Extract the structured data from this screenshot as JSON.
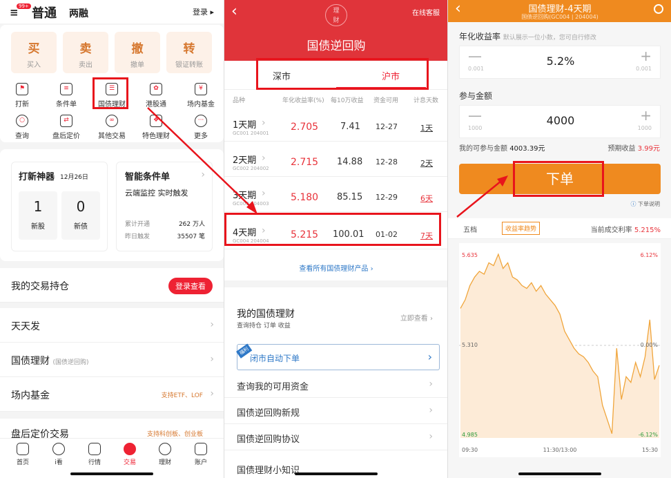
{
  "colors": {
    "brand_red": "#e0343a",
    "orange": "#ef8a1f",
    "price_red": "#e8323a"
  },
  "home": {
    "status_badge": "99+",
    "tabs": [
      "普通",
      "两融"
    ],
    "login": "登录",
    "big_buttons": [
      {
        "t": "买",
        "s": "买入"
      },
      {
        "t": "卖",
        "s": "卖出"
      },
      {
        "t": "撤",
        "s": "撤单"
      },
      {
        "t": "转",
        "s": "银证转账"
      }
    ],
    "grid": [
      {
        "label": "打新",
        "icon": "flag-icon"
      },
      {
        "label": "条件单",
        "icon": "document-icon"
      },
      {
        "label": "国债理财",
        "icon": "ticket-icon"
      },
      {
        "label": "港股通",
        "icon": "hk-icon"
      },
      {
        "label": "场内基金",
        "icon": "shield-icon"
      },
      {
        "label": "查询",
        "icon": "search-icon"
      },
      {
        "label": "盘后定价",
        "icon": "exchange-icon"
      },
      {
        "label": "其他交易",
        "icon": "loop-icon"
      },
      {
        "label": "特色理财",
        "icon": "gift-icon"
      },
      {
        "label": "更多",
        "icon": "more-icon"
      }
    ],
    "ipo": {
      "title": "打新神器",
      "date": "12月26日",
      "stocks_count": "1",
      "stocks_label": "新股",
      "bonds_count": "0",
      "bonds_label": "新债"
    },
    "smart": {
      "title": "智能条件单",
      "desc": "云端监控 实时触发",
      "row1_label": "累计开通",
      "row1_value": "262 万人",
      "row2_label": "昨日触发",
      "row2_value": "35507 笔"
    },
    "holdings_label": "我的交易持仓",
    "holdings_btn": "登录查看",
    "menu": [
      {
        "label": "天天发",
        "sub": "",
        "right": ""
      },
      {
        "label": "国债理财",
        "sub": "(国债逆回购)",
        "right": ""
      },
      {
        "label": "场内基金",
        "sub": "",
        "right": "支持ETF、LOF"
      },
      {
        "label": "盘后定价交易",
        "sub": "",
        "right": "支持科创板、创业板"
      }
    ],
    "tabbar": [
      "首页",
      "i看",
      "行情",
      "交易",
      "理财",
      "账户"
    ]
  },
  "repo": {
    "logo_top": "理",
    "logo_bottom": "财",
    "service": "在线客服",
    "title": "国债逆回购",
    "markets": [
      "深市",
      "沪市"
    ],
    "headers": [
      "品种",
      "年化收益率(%)",
      "每10万收益",
      "资金可用",
      "计息天数"
    ],
    "rows": [
      {
        "name": "1天期",
        "code": "GC001 204001",
        "rate": "2.705",
        "income": "7.41",
        "avail": "12-27",
        "days": "1天"
      },
      {
        "name": "2天期",
        "code": "GC002 204002",
        "rate": "2.715",
        "income": "14.88",
        "avail": "12-28",
        "days": "2天"
      },
      {
        "name": "3天期",
        "code": "GC003 204003",
        "rate": "5.180",
        "income": "85.15",
        "avail": "12-29",
        "days": "6天"
      },
      {
        "name": "4天期",
        "code": "GC004 204004",
        "rate": "5.215",
        "income": "100.01",
        "avail": "01-02",
        "days": "7天"
      }
    ],
    "view_all": "查看所有国债理财产品",
    "my_title": "我的国债理财",
    "my_sub": "查询持仓 订单 收益",
    "my_link": "立即查看",
    "auto_tag": "福利",
    "auto_label": "闭市自动下单",
    "links": [
      "查询我的可用资金",
      "国债逆回购新规",
      "国债逆回购协议",
      "国债理财小知识"
    ]
  },
  "order": {
    "title": "国债理财-4天期",
    "subtitle": "国债逆回购(GC004 | 204004)",
    "rate_label": "年化收益率",
    "rate_hint": "默认展示一位小数，您可自行修改",
    "rate_value": "5.2%",
    "rate_step": "0.001",
    "amount_label": "参与金额",
    "amount_value": "4000",
    "amount_step": "1000",
    "avail_label": "我的可参与金额",
    "avail_value": "4003.39元",
    "expect_label": "预期收益",
    "expect_value": "3.99元",
    "submit": "下单",
    "help": "下单说明",
    "tabs": [
      "五档",
      "收益率趋势"
    ],
    "current_label": "当前成交利率",
    "current_value": "5.215%"
  },
  "chart_data": {
    "type": "line",
    "title": "",
    "x": [
      "09:30",
      "11:30/13:00",
      "15:30"
    ],
    "y_ticks": [
      "5.635",
      "5.310",
      "4.985"
    ],
    "pct_ticks": [
      "6.12%",
      "0.00%",
      "-6.12%"
    ],
    "ylim": [
      4.985,
      5.635
    ],
    "series": [
      {
        "values": [
          5.44,
          5.47,
          5.52,
          5.55,
          5.57,
          5.56,
          5.6,
          5.59,
          5.63,
          5.58,
          5.6,
          5.55,
          5.54,
          5.52,
          5.51,
          5.53,
          5.5,
          5.52,
          5.49,
          5.47,
          5.45,
          5.42,
          5.36,
          5.33,
          5.3,
          5.28,
          5.27,
          5.25,
          5.22,
          5.2,
          5.1,
          5.05,
          5.0,
          5.3,
          5.12,
          5.2,
          5.18,
          5.25,
          5.2,
          5.27,
          5.4,
          5.19,
          5.24
        ]
      }
    ]
  }
}
